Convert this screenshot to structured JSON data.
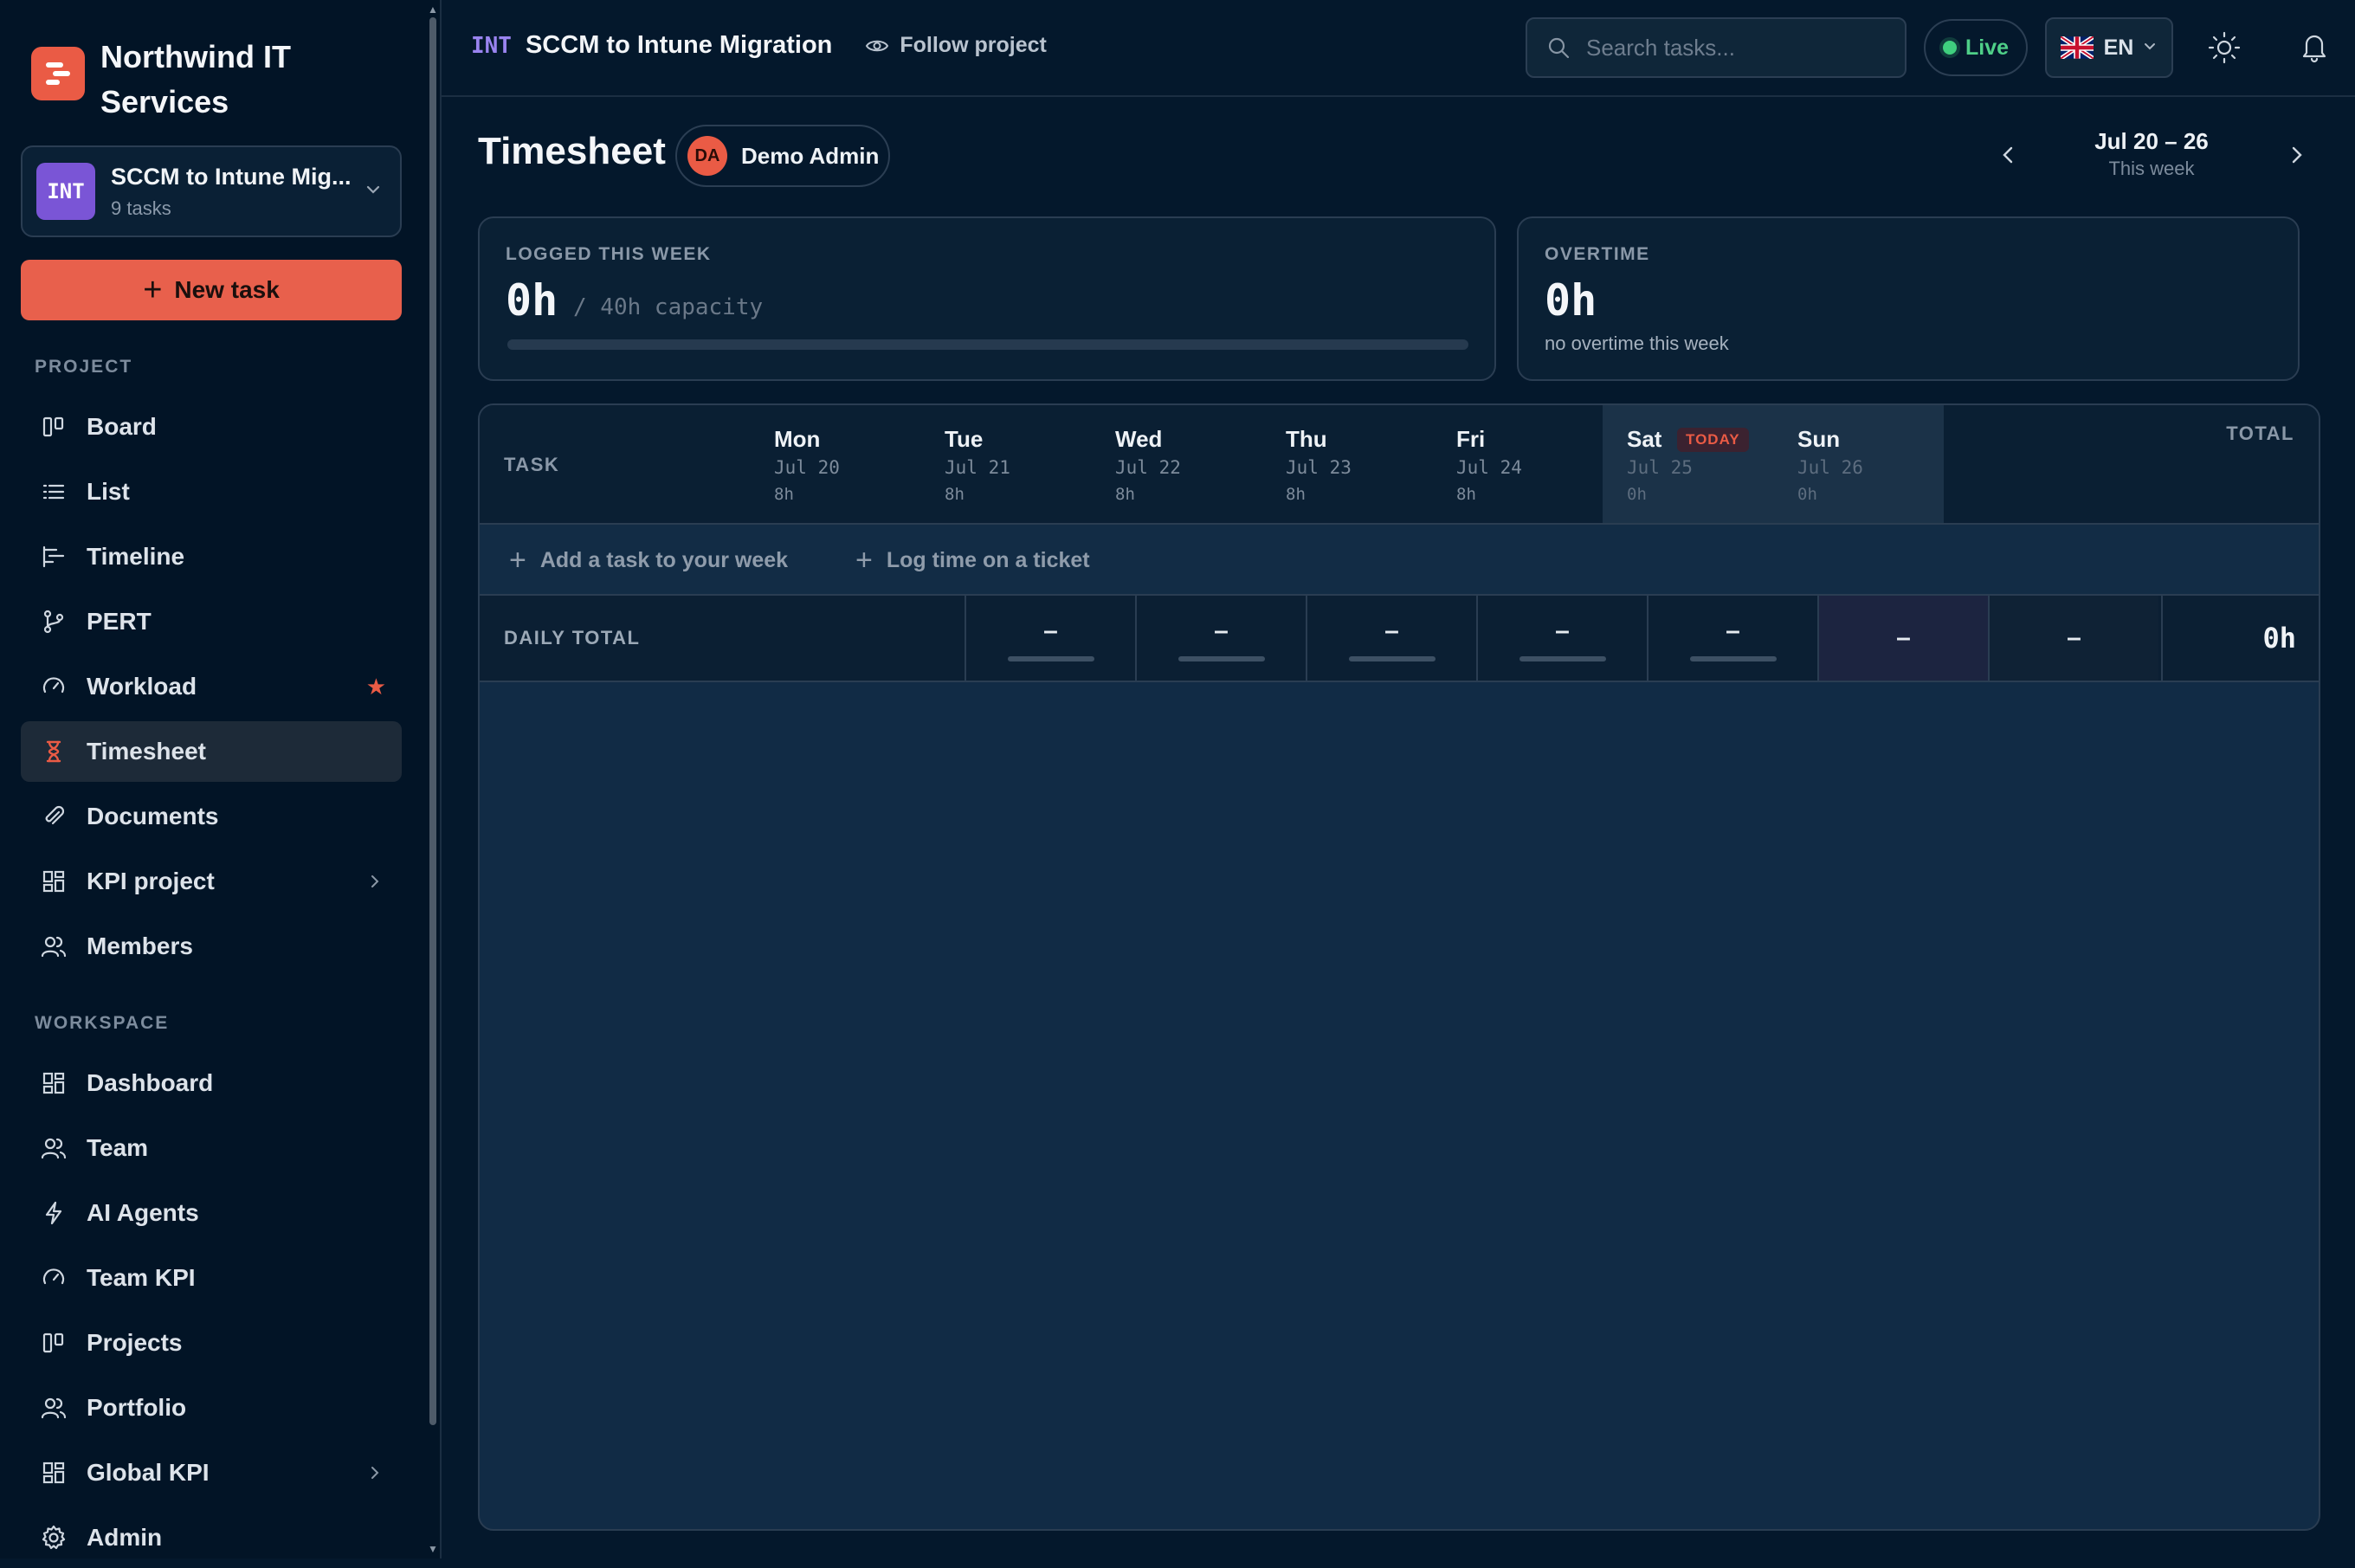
{
  "brand": {
    "name": "Northwind IT Services",
    "color": "#ea5b45"
  },
  "project": {
    "key": "INT",
    "name": "SCCM to Intune Mig...",
    "task_count": "9 tasks",
    "badge_color": "#7a55d6"
  },
  "sidebar": {
    "new_task_label": "New task",
    "project_section": "PROJECT",
    "project_items": [
      {
        "label": "Board",
        "icon": "board-icon"
      },
      {
        "label": "List",
        "icon": "list-icon"
      },
      {
        "label": "Timeline",
        "icon": "timeline-icon"
      },
      {
        "label": "PERT",
        "icon": "pert-icon"
      },
      {
        "label": "Workload",
        "icon": "gauge-icon",
        "starred": true
      },
      {
        "label": "Timesheet",
        "icon": "hourglass-icon",
        "active": true
      },
      {
        "label": "Documents",
        "icon": "paperclip-icon"
      },
      {
        "label": "KPI project",
        "icon": "dashboard-icon",
        "expandable": true
      },
      {
        "label": "Members",
        "icon": "users-icon"
      }
    ],
    "workspace_section": "WORKSPACE",
    "workspace_items": [
      {
        "label": "Dashboard",
        "icon": "dashboard-icon"
      },
      {
        "label": "Team",
        "icon": "users-icon"
      },
      {
        "label": "AI Agents",
        "icon": "bolt-icon"
      },
      {
        "label": "Team KPI",
        "icon": "gauge-icon"
      },
      {
        "label": "Projects",
        "icon": "board-icon"
      },
      {
        "label": "Portfolio",
        "icon": "users-icon"
      },
      {
        "label": "Global KPI",
        "icon": "dashboard-icon",
        "expandable": true
      },
      {
        "label": "Admin",
        "icon": "gear-icon"
      }
    ]
  },
  "topbar": {
    "project_key": "INT",
    "project_title": "SCCM to Intune Migration",
    "follow_label": "Follow project",
    "search_placeholder": "Search tasks...",
    "live_label": "Live",
    "lang_label": "EN"
  },
  "timesheet": {
    "title": "Timesheet",
    "user_initials": "DA",
    "user_name": "Demo Admin",
    "week_range": "Jul 20 – 26",
    "week_sub": "This week",
    "logged_label": "LOGGED THIS WEEK",
    "logged_value": "0h",
    "capacity_label": "/ 40h capacity",
    "logged_progress_percent": 0,
    "overtime_label": "OVERTIME",
    "overtime_value": "0h",
    "overtime_sub": "no overtime this week",
    "columns": {
      "task": "TASK",
      "total": "TOTAL",
      "days": [
        {
          "name": "Mon",
          "date": "Jul 20",
          "capacity": "8h"
        },
        {
          "name": "Tue",
          "date": "Jul 21",
          "capacity": "8h"
        },
        {
          "name": "Wed",
          "date": "Jul 22",
          "capacity": "8h"
        },
        {
          "name": "Thu",
          "date": "Jul 23",
          "capacity": "8h"
        },
        {
          "name": "Fri",
          "date": "Jul 24",
          "capacity": "8h"
        },
        {
          "name": "Sat",
          "date": "Jul 25",
          "capacity": "0h",
          "today": true
        },
        {
          "name": "Sun",
          "date": "Jul 26",
          "capacity": "0h"
        }
      ],
      "today_badge": "TODAY"
    },
    "add_task_label": "Add a task to your week",
    "log_time_label": "Log time on a ticket",
    "daily_total_label": "DAILY TOTAL",
    "daily_totals": [
      "–",
      "–",
      "–",
      "–",
      "–",
      "–",
      "–"
    ],
    "week_total": "0h"
  }
}
